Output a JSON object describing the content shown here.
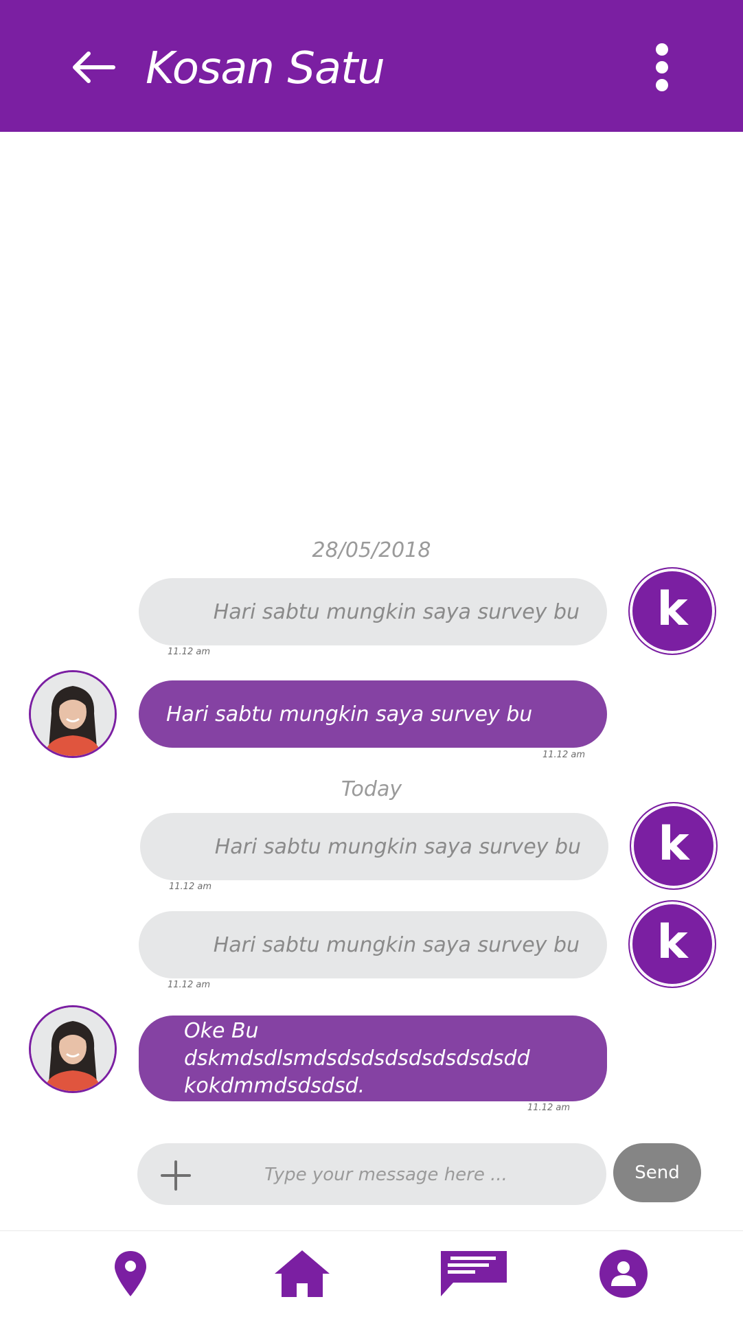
{
  "header": {
    "title": "Kosan Satu",
    "back_icon": "arrow-left-icon",
    "menu_icon": "more-vertical-icon"
  },
  "colors": {
    "brand": "#7b1fa2",
    "incoming_bubble": "#8542a3",
    "outgoing_bubble": "#e6e7e8",
    "send_button": "#858585"
  },
  "separators": {
    "first": "28/05/2018",
    "second": "Today"
  },
  "messages": [
    {
      "side": "outgoing",
      "text": "Hari sabtu mungkin saya survey bu",
      "time": "11.12 am",
      "avatar_letter": "k"
    },
    {
      "side": "incoming",
      "text": "Hari sabtu mungkin saya survey bu",
      "time": "11.12 am"
    },
    {
      "side": "outgoing",
      "text": "Hari sabtu mungkin saya survey bu",
      "time": "11.12 am",
      "avatar_letter": "k"
    },
    {
      "side": "outgoing",
      "text": "Hari sabtu mungkin saya survey bu",
      "time": "11.12 am",
      "avatar_letter": "k"
    },
    {
      "side": "incoming",
      "text": "Oke Bu dskmdsdlsmdsdsdsdsdsdsdsdsdd\nkokdmmdsdsdsd.",
      "time": "11.12 am"
    }
  ],
  "composer": {
    "placeholder": "Type your message here ...",
    "value": "",
    "plus_icon": "plus-icon",
    "send_label": "Send"
  },
  "bottom_nav": [
    {
      "icon": "location-pin-icon"
    },
    {
      "icon": "home-icon"
    },
    {
      "icon": "chat-icon"
    },
    {
      "icon": "profile-icon"
    }
  ]
}
